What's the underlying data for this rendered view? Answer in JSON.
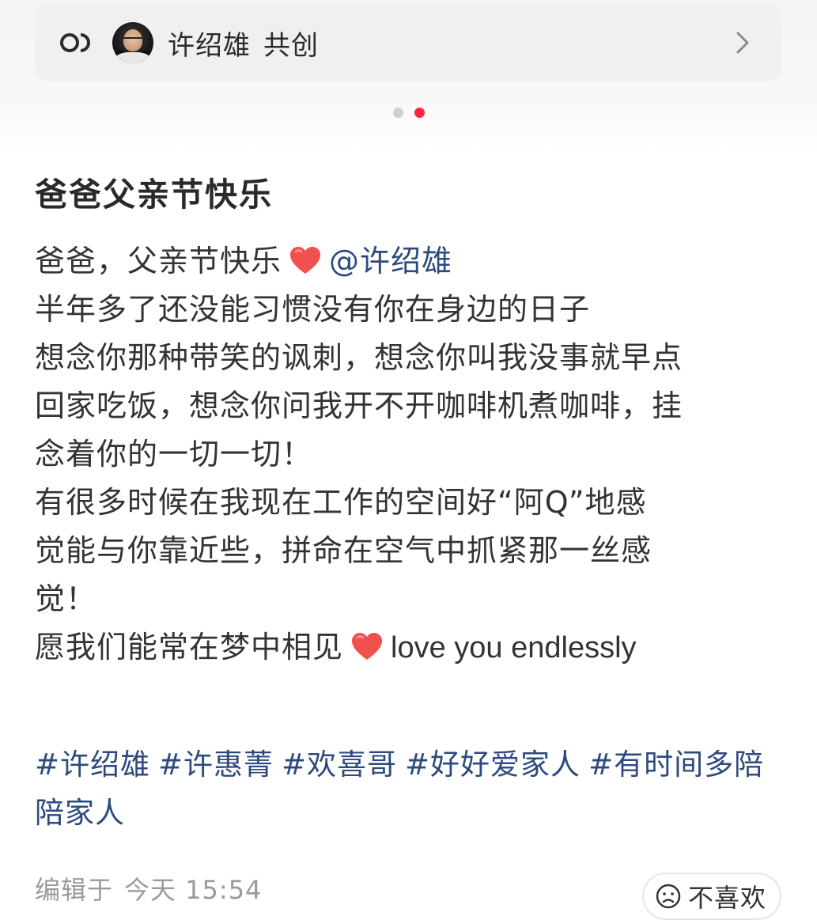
{
  "cocreate": {
    "icon": "cocreate-link-icon",
    "name": "许绍雄",
    "label": "共创",
    "chevron": "chevron-right-icon"
  },
  "carousel": {
    "count": 2,
    "active_index": 1,
    "active_color": "#ff2442",
    "inactive_color": "#cfcfcf"
  },
  "post": {
    "title": "爸爸父亲节快乐",
    "lines": [
      {
        "segments": [
          {
            "type": "text",
            "text": "爸爸，父亲节快乐"
          },
          {
            "type": "icon",
            "icon": "red-heart-icon"
          },
          {
            "type": "mention",
            "text": "@许绍雄"
          }
        ]
      },
      {
        "segments": [
          {
            "type": "text",
            "text": "半年多了还没能习惯没有你在身边的日子"
          }
        ]
      },
      {
        "segments": [
          {
            "type": "text",
            "text": "想念你那种带笑的讽刺，想念你叫我没事就早点"
          }
        ]
      },
      {
        "segments": [
          {
            "type": "text",
            "text": "回家吃饭，想念你问我开不开咖啡机煮咖啡，挂"
          }
        ]
      },
      {
        "segments": [
          {
            "type": "text",
            "text": "念着你的一切一切！"
          }
        ]
      },
      {
        "segments": [
          {
            "type": "text",
            "text": "有很多时候在我现在工作的空间好“阿Q”地感"
          }
        ]
      },
      {
        "segments": [
          {
            "type": "text",
            "text": "觉能与你靠近些，拼命在空气中抓紧那一丝感"
          }
        ]
      },
      {
        "segments": [
          {
            "type": "text",
            "text": "觉！"
          }
        ]
      },
      {
        "segments": [
          {
            "type": "text",
            "text": "愿我们能常在梦中相见"
          },
          {
            "type": "icon",
            "icon": "red-heart-icon"
          },
          {
            "type": "latin",
            "text": "love you endlessly"
          }
        ]
      }
    ],
    "tags": [
      "#许绍雄",
      "#许惠菁",
      "#欢喜哥",
      "#好好爱家人",
      "#有时间多陪陪家人"
    ],
    "tag_color": "#2d4a7f",
    "edited_prefix": "编辑于",
    "edited_time": "今天 15:54"
  },
  "dislike": {
    "icon": "frown-face-icon",
    "label": "不喜欢"
  }
}
